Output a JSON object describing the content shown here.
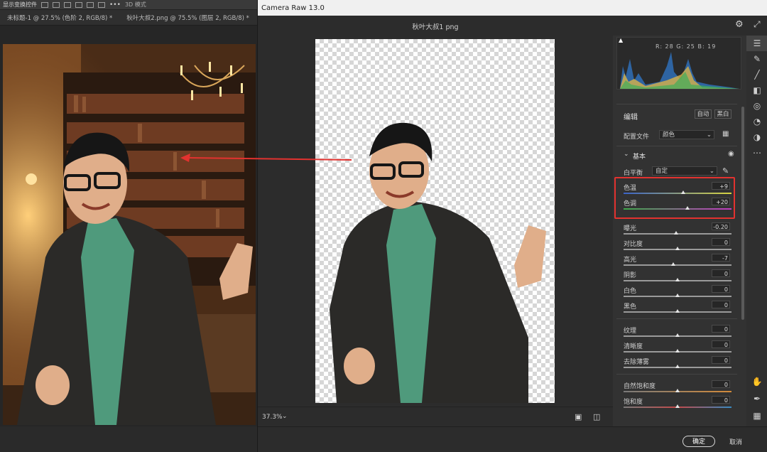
{
  "photoshop": {
    "topbar_label": "显示变换控件",
    "tabs": [
      {
        "label": "未标题-1 @ 27.5% (色阶 2, RGB/8) *"
      },
      {
        "label": "秋叶大叔2.png @ 75.5% (图层 2, RGB/8) *"
      }
    ],
    "topbar_extra": "3D 模式"
  },
  "camera_raw": {
    "window_title": "Camera Raw 13.0",
    "filename": "秋叶大叔1 png",
    "zoom": "37.3%",
    "ok_label": "确定",
    "cancel_label": "取消",
    "histogram": {
      "r": "R: 28",
      "g": "G: 25",
      "b": "B: 19"
    },
    "edit": {
      "title": "编辑",
      "auto_label": "自动",
      "bw_label": "黑白",
      "profile_label": "配置文件",
      "profile_value": "颜色"
    },
    "basic": {
      "title": "基本",
      "wb_label": "白平衡",
      "wb_value": "自定",
      "sliders": [
        {
          "label": "色温",
          "value": "+9",
          "fraction": 0.55,
          "track": "temp"
        },
        {
          "label": "色调",
          "value": "+20",
          "fraction": 0.59,
          "track": "tint"
        },
        {
          "label": "曝光",
          "value": "-0.20",
          "fraction": 0.49,
          "track": "gray"
        },
        {
          "label": "对比度",
          "value": "0",
          "fraction": 0.5,
          "track": "gray"
        },
        {
          "label": "高光",
          "value": "-7",
          "fraction": 0.46,
          "track": "gray"
        },
        {
          "label": "阴影",
          "value": "0",
          "fraction": 0.5,
          "track": "gray"
        },
        {
          "label": "白色",
          "value": "0",
          "fraction": 0.5,
          "track": "gray"
        },
        {
          "label": "黑色",
          "value": "0",
          "fraction": 0.5,
          "track": "gray"
        },
        {
          "label": "纹理",
          "value": "0",
          "fraction": 0.5,
          "track": "gray"
        },
        {
          "label": "清晰度",
          "value": "0",
          "fraction": 0.5,
          "track": "gray"
        },
        {
          "label": "去除薄雾",
          "value": "0",
          "fraction": 0.5,
          "track": "gray"
        },
        {
          "label": "自然饱和度",
          "value": "0",
          "fraction": 0.5,
          "track": "vib"
        },
        {
          "label": "饱和度",
          "value": "0",
          "fraction": 0.5,
          "track": "sat"
        }
      ]
    },
    "colors": {
      "accent": "#e2322f",
      "panel_bg": "#323232"
    }
  }
}
